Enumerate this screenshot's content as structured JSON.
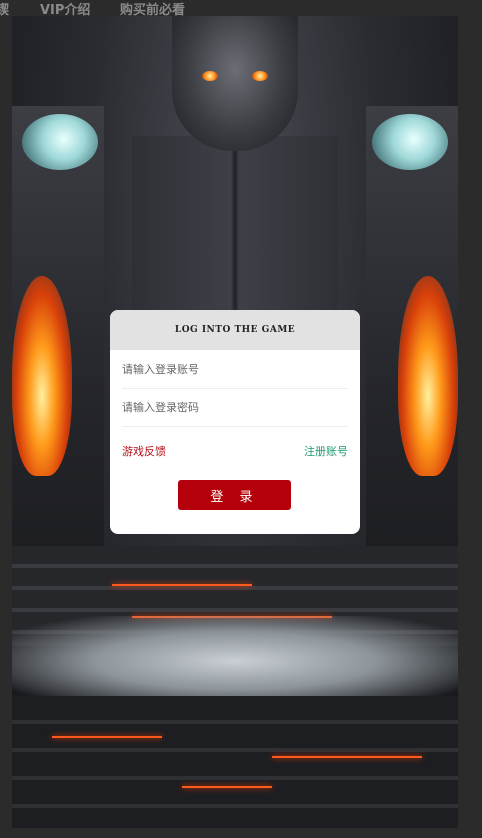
{
  "topnav": {
    "items": [
      "锲",
      "VIP介绍",
      "购买前必看"
    ]
  },
  "login": {
    "title": "LOG INTO THE GAME",
    "account_placeholder": "请输入登录账号",
    "password_placeholder": "请输入登录密码",
    "feedback_link": "游戏反馈",
    "register_link": "注册账号",
    "submit_label": "登 录"
  },
  "colors": {
    "accent_red": "#b3000a",
    "feedback_red": "#b3121a",
    "register_green": "#1f9a6f",
    "header_gray": "#e2e2e2"
  }
}
